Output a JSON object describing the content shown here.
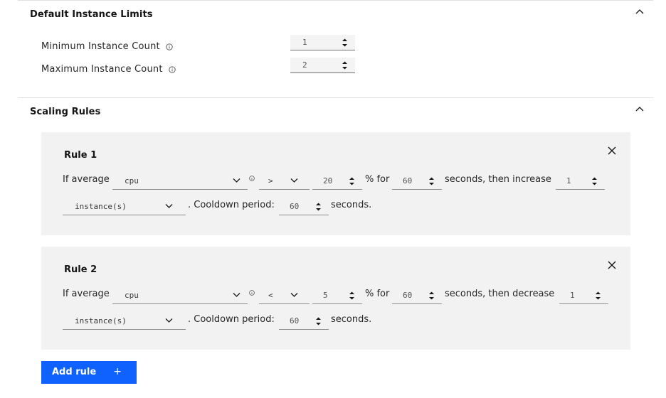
{
  "limits_section": {
    "title": "Default Instance Limits",
    "min_label": "Minimum Instance Count",
    "min_value": "1",
    "max_label": "Maximum Instance Count",
    "max_value": "2"
  },
  "rules_section": {
    "title": "Scaling Rules",
    "rules": [
      {
        "title": "Rule 1",
        "if_text": "If average",
        "metric": "cpu",
        "operator": ">",
        "threshold": "20",
        "pct_for_text": "% for",
        "seconds_value": "60",
        "then_text": "seconds, then increase",
        "adjust_value": "1",
        "unit": "instance(s)",
        "cooldown_text": ". Cooldown period:",
        "cooldown_value": "60",
        "seconds_text": "seconds."
      },
      {
        "title": "Rule 2",
        "if_text": "If average",
        "metric": "cpu",
        "operator": "<",
        "threshold": "5",
        "pct_for_text": "% for",
        "seconds_value": "60",
        "then_text": "seconds, then decrease",
        "adjust_value": "1",
        "unit": "instance(s)",
        "cooldown_text": ". Cooldown period:",
        "cooldown_value": "60",
        "seconds_text": "seconds."
      }
    ],
    "add_rule_label": "Add rule",
    "add_rule_icon": "+"
  },
  "colors": {
    "primary": "#0f62fe",
    "card_bg": "#f2f2f2",
    "input_bg": "#f4f4f4"
  }
}
